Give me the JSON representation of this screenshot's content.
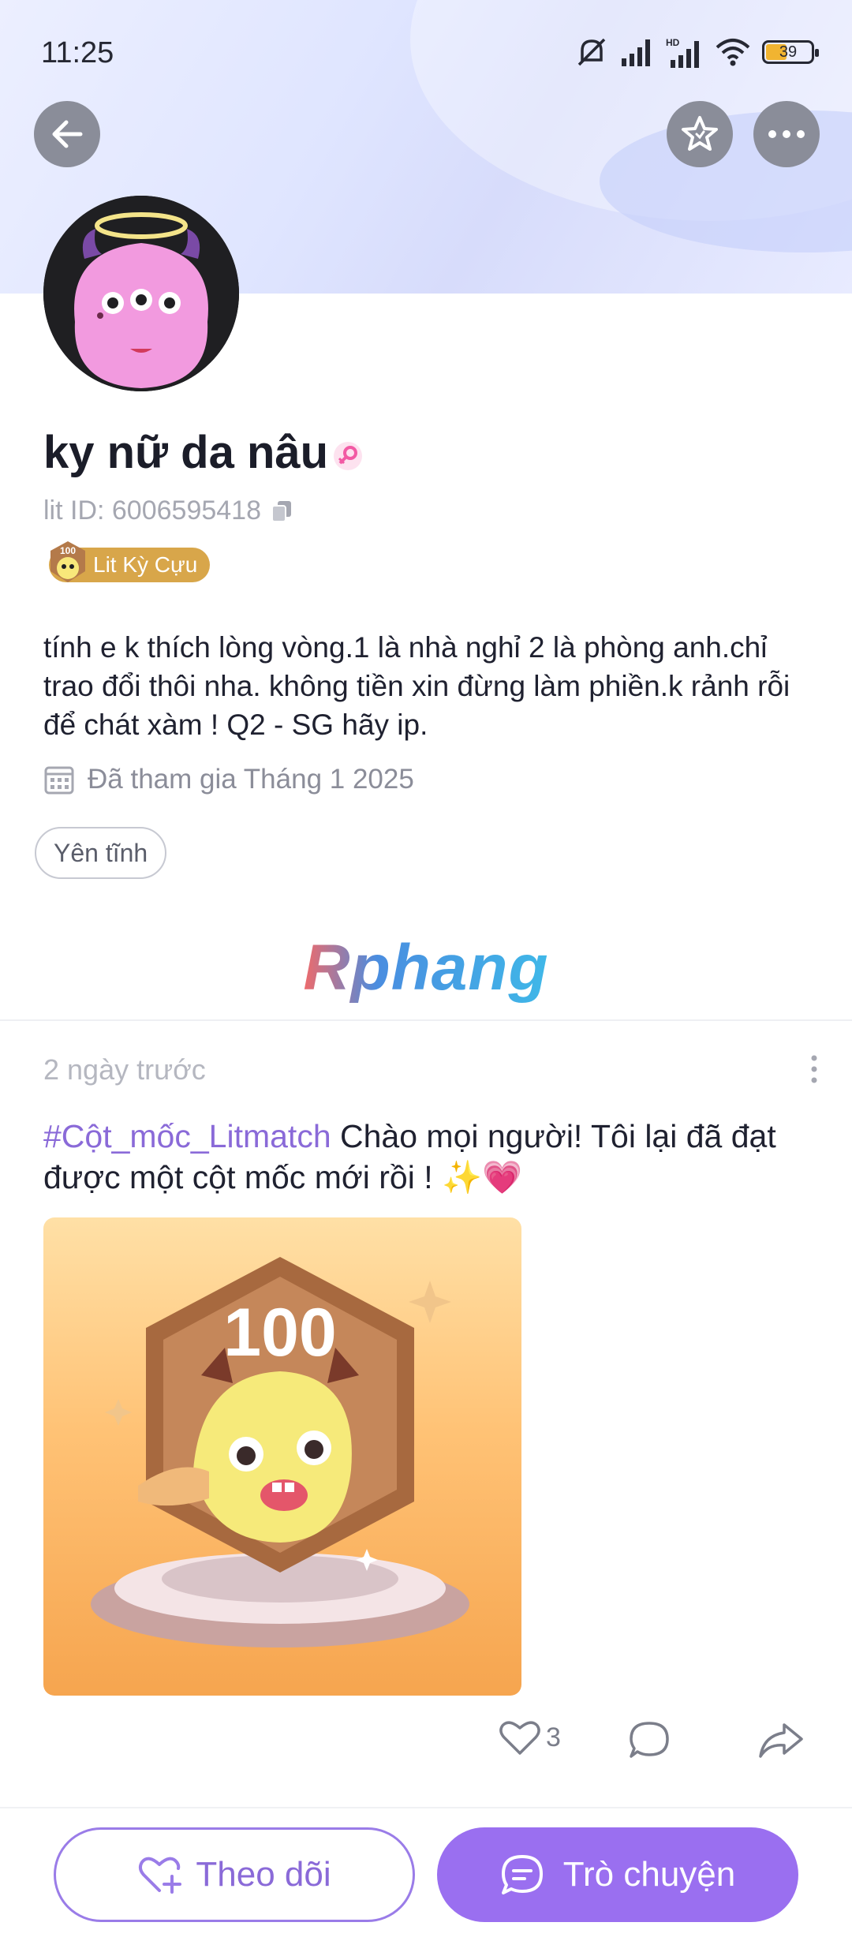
{
  "status_bar": {
    "time": "11:25",
    "battery": "39"
  },
  "profile": {
    "name": "ky nữ da nâu",
    "lit_id": "lit ID: 6006595418",
    "badge": "Lit Kỳ Cựu",
    "badge_number": "100",
    "bio": "tính e k thích lòng vòng.1 là nhà nghỉ 2 là phòng anh.chỉ trao đổi thôi nha. không tiền xin đừng làm phiền.k rảnh rỗi để chát xàm ! Q2 - SG hãy ip.",
    "joined": "Đã tham gia Tháng 1 2025",
    "tag": "Yên tĩnh"
  },
  "watermark": "Rphang",
  "post": {
    "time": "2 ngày trước",
    "hashtag": "#Cột_mốc_Litmatch",
    "text": " Chào mọi người! Tôi lại đã đạt được một cột mốc mới rồi ! ✨💗",
    "image_number": "100",
    "likes": "3"
  },
  "bottom": {
    "follow_label": "Theo dõi",
    "chat_label": "Trò chuyện"
  },
  "icons": [
    "back-arrow-icon",
    "star-icon",
    "more-icon",
    "copy-icon",
    "calendar-icon",
    "heart-icon",
    "comment-icon",
    "share-icon",
    "heart-plus-icon",
    "chat-icon"
  ],
  "colors": {
    "accent": "#9a6ff0",
    "badge": "#d8a64a",
    "hashtag": "#8a6ad8"
  }
}
